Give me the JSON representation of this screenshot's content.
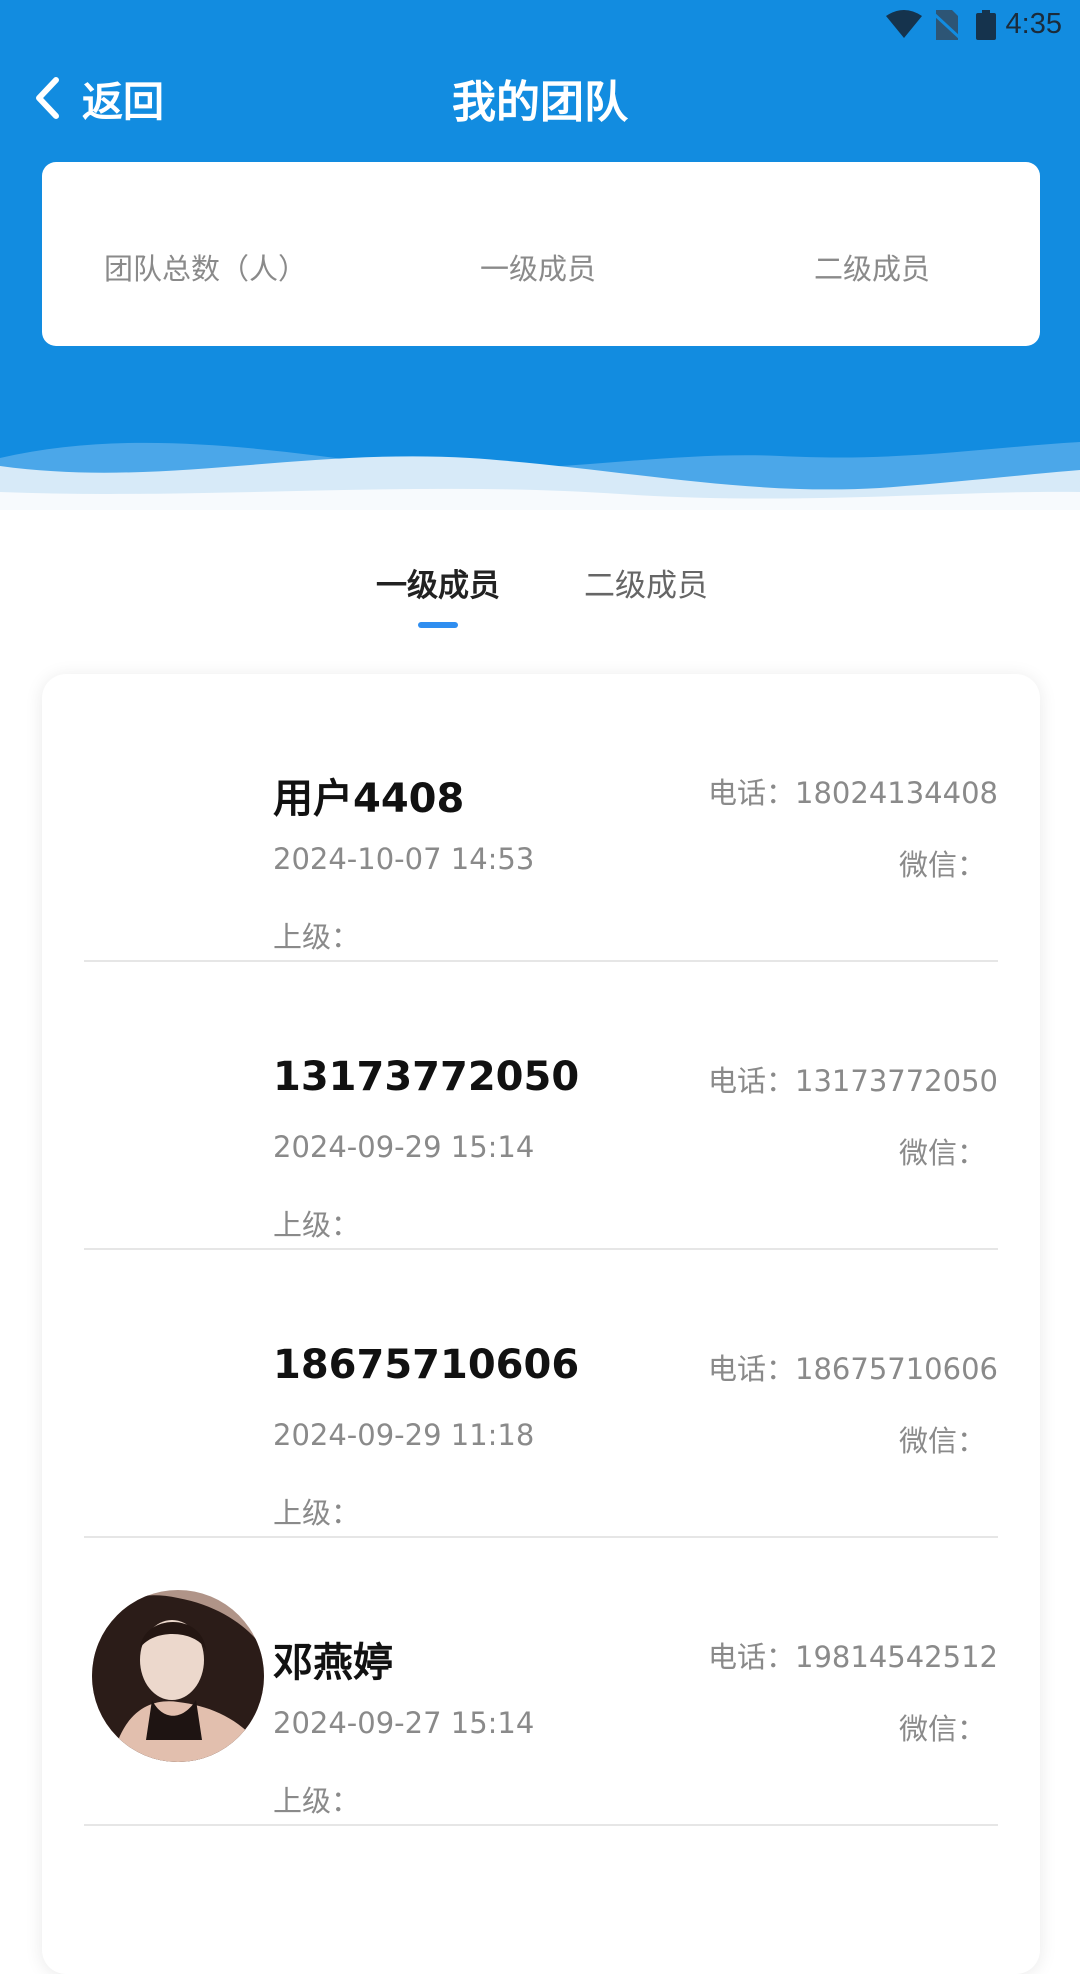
{
  "status_bar": {
    "time": "4:35"
  },
  "header": {
    "back_label": "返回",
    "title": "我的团队"
  },
  "stats": {
    "total_label": "团队总数（人）",
    "level1_label": "一级成员",
    "level2_label": "二级成员"
  },
  "tabs": [
    {
      "label": "一级成员",
      "active": true
    },
    {
      "label": "二级成员",
      "active": false
    }
  ],
  "members": [
    {
      "name": "用户4408",
      "date": "2024-10-07 14:53",
      "phone": "电话：18024134408",
      "wechat": "微信：",
      "superior": "上级："
    },
    {
      "name": "13173772050",
      "date": "2024-09-29 15:14",
      "phone": "电话：13173772050",
      "wechat": "微信：",
      "superior": "上级："
    },
    {
      "name": "18675710606",
      "date": "2024-09-29 11:18",
      "phone": "电话：18675710606",
      "wechat": "微信：",
      "superior": "上级："
    },
    {
      "name": "邓燕婷",
      "date": "2024-09-27 15:14",
      "phone": "电话：19814542512",
      "wechat": "微信：",
      "superior": "上级："
    }
  ],
  "colors": {
    "primary": "#128ce0",
    "tab_indicator": "#2f8ef0",
    "text_secondary": "#8a8a8a"
  }
}
